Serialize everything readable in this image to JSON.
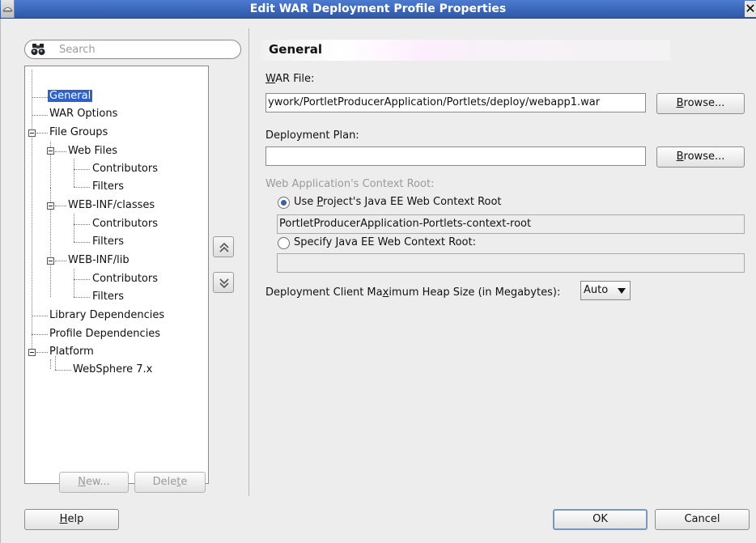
{
  "window": {
    "title": "Edit WAR Deployment Profile Properties",
    "close_glyph": "✕"
  },
  "search": {
    "placeholder": "Search"
  },
  "nav_tree": {
    "items": [
      {
        "label": "General"
      },
      {
        "label": "WAR Options"
      },
      {
        "label": "File Groups"
      },
      {
        "label": "Web Files"
      },
      {
        "label": "Contributors"
      },
      {
        "label": "Filters"
      },
      {
        "label": "WEB-INF/classes"
      },
      {
        "label": "Contributors"
      },
      {
        "label": "Filters"
      },
      {
        "label": "WEB-INF/lib"
      },
      {
        "label": "Contributors"
      },
      {
        "label": "Filters"
      },
      {
        "label": "Library Dependencies"
      },
      {
        "label": "Profile Dependencies"
      },
      {
        "label": "Platform"
      },
      {
        "label": "WebSphere 7.x"
      }
    ],
    "selected": "General",
    "new_button": {
      "pre": "",
      "mnemonic": "N",
      "post": "ew..."
    },
    "delete_button": {
      "pre": "Dele",
      "mnemonic": "t",
      "post": "e"
    }
  },
  "general": {
    "section_title": "General",
    "war_file": {
      "label_mnemonic": "W",
      "label_rest": "AR File:",
      "value": "ywork/PortletProducerApplication/Portlets/deploy/webapp1.war",
      "browse": {
        "mnemonic": "B",
        "rest": "rowse..."
      }
    },
    "deployment_plan": {
      "label": "Deployment Plan:",
      "value": "",
      "browse": {
        "mnemonic": "B",
        "rest": "rowse..."
      }
    },
    "context_root": {
      "label": "Web Application's Context Root:",
      "option_project": {
        "pre": "Use ",
        "mnemonic": "P",
        "post": "roject's Java EE Web Context Root",
        "selected": true
      },
      "project_value": "PortletProducerApplication-Portlets-context-root",
      "option_specify": {
        "pre": "Specify ",
        "mnemonic": "J",
        "post": "ava EE Web Context Root:",
        "selected": false
      },
      "specify_value": ""
    },
    "heap_size": {
      "label_pre": "Deployment Client Ma",
      "label_mnemonic": "x",
      "label_post": "imum Heap Size (in Megabytes):",
      "value": "Auto"
    }
  },
  "footer": {
    "help": {
      "mnemonic": "H",
      "rest": "elp"
    },
    "ok": "OK",
    "cancel": "Cancel"
  },
  "colors": {
    "title_bar": "#3a66b8",
    "selection": "#2d62c8",
    "dialog_bg": "#ededed"
  },
  "icons": [
    "app-icon",
    "binoculars-icon",
    "close-icon",
    "move-up-icon",
    "move-down-icon",
    "dropdown-caret-icon"
  ]
}
